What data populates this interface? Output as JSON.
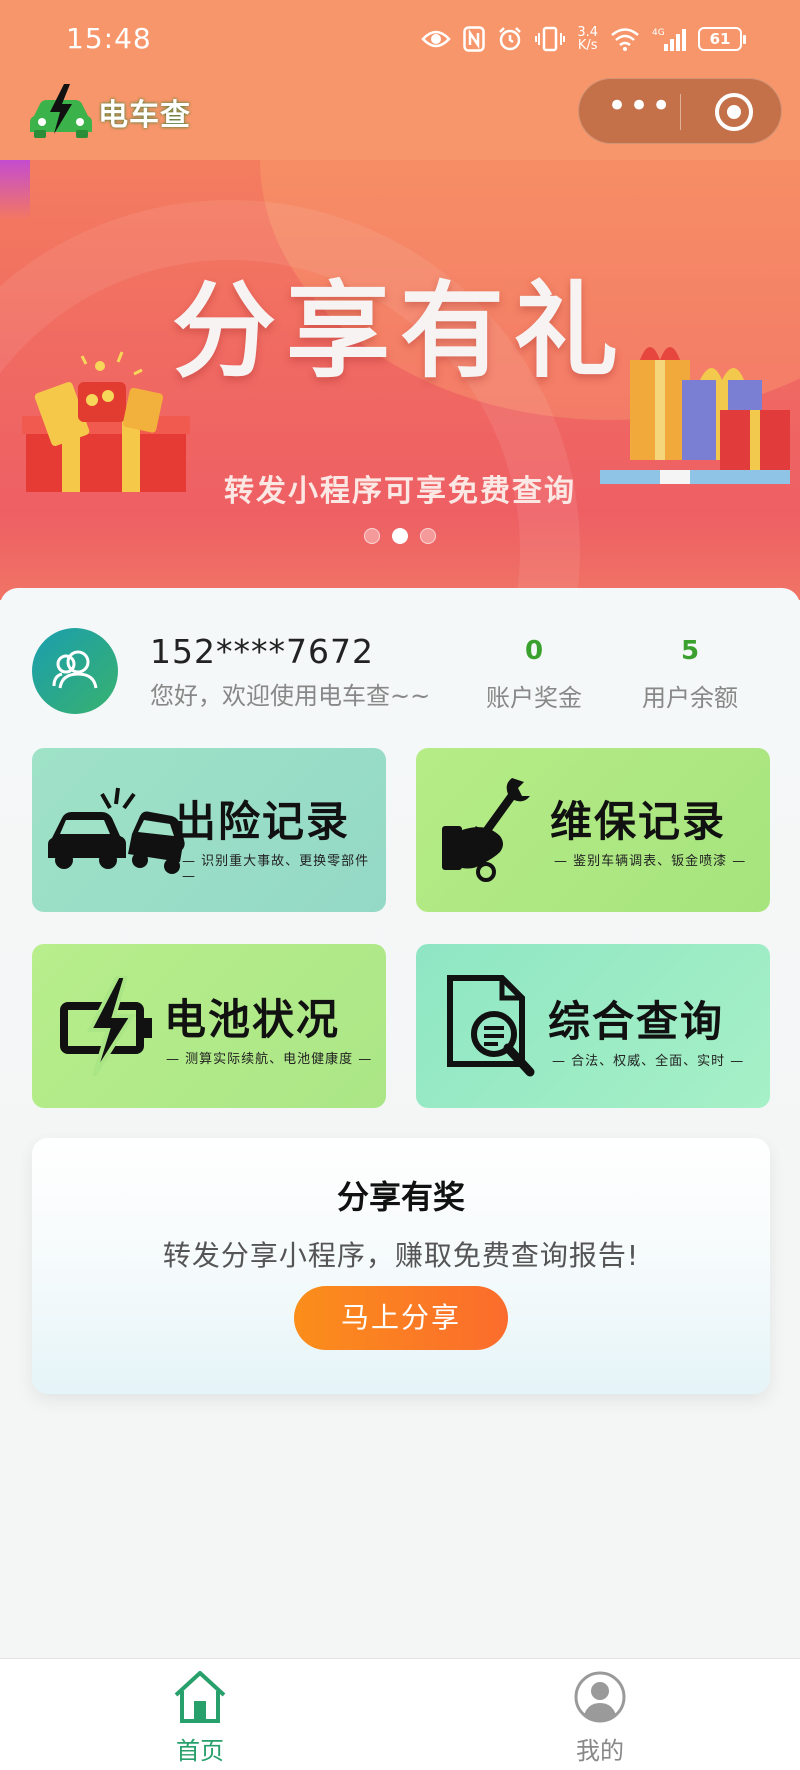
{
  "status_bar": {
    "time": "15:48",
    "network_speed": "3.4\nK/s",
    "network_type": "4G",
    "battery": "61"
  },
  "header": {
    "app_name": "电车查"
  },
  "banner": {
    "title": "分享有礼",
    "subtitle": "转发小程序可享免费查询",
    "slide_count": 3,
    "active_slide": 2
  },
  "user": {
    "phone": "152****7672",
    "welcome": "您好，欢迎使用电车查~~",
    "stats": [
      {
        "value": "0",
        "label": "账户奖金"
      },
      {
        "value": "5",
        "label": "用户余额"
      }
    ]
  },
  "features": [
    {
      "title": "出险记录",
      "desc": "— 识别重大事故、更换零部件 —",
      "icon": "car-crash-icon"
    },
    {
      "title": "维保记录",
      "desc": "— 鉴别车辆调表、钣金喷漆 —",
      "icon": "wrench-hand-icon"
    },
    {
      "title": "电池状况",
      "desc": "— 测算实际续航、电池健康度 —",
      "icon": "battery-bolt-icon"
    },
    {
      "title": "综合查询",
      "desc": "— 合法、权威、全面、实时 —",
      "icon": "document-search-icon"
    }
  ],
  "share": {
    "title": "分享有奖",
    "desc": "转发分享小程序，赚取免费查询报告!",
    "button": "马上分享"
  },
  "tabbar": {
    "tabs": [
      {
        "label": "首页",
        "icon": "home-icon",
        "active": true
      },
      {
        "label": "我的",
        "icon": "user-icon",
        "active": false
      }
    ]
  },
  "colors": {
    "header_bg": "#f7966a",
    "accent_green": "#3aa02e",
    "share_button": "#fb7d22"
  }
}
